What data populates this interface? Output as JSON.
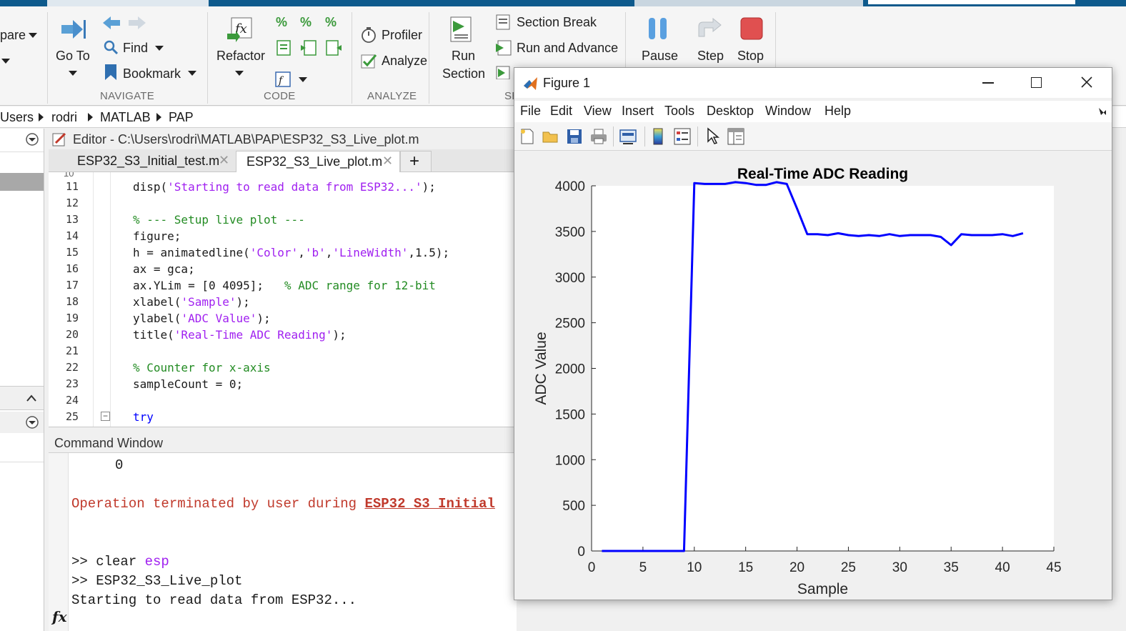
{
  "ribbon": {
    "compare_label": "pare",
    "goto_label": "Go To",
    "find_label": "Find",
    "bookmark_label": "Bookmark",
    "navigate_section": "NAVIGATE",
    "refactor_label": "Refactor",
    "code_section": "CODE",
    "profiler_label": "Profiler",
    "analyze_label": "Analyze",
    "analyze_section": "ANALYZE",
    "run_section_label_1": "Run",
    "run_section_label_2": "Section",
    "section_break_label": "Section Break",
    "run_advance_label": "Run and Advance",
    "section_partial": "SE",
    "pause_label": "Pause",
    "step_label": "Step",
    "stop_label": "Stop"
  },
  "address": {
    "parts": [
      "Users",
      "rodri",
      "MATLAB",
      "PAP"
    ]
  },
  "editor": {
    "title": "Editor - C:\\Users\\rodri\\MATLAB\\PAP\\ESP32_S3_Live_plot.m",
    "tabs": [
      {
        "label": "ESP32_S3_Initial_test.m"
      },
      {
        "label": "ESP32_S3_Live_plot.m"
      }
    ],
    "lines": [
      {
        "n": "11",
        "parts": [
          [
            "",
            "disp("
          ],
          [
            "cstr",
            "'Starting to read data from ESP32...'"
          ],
          [
            "",
            ");"
          ]
        ]
      },
      {
        "n": "12",
        "parts": []
      },
      {
        "n": "13",
        "parts": [
          [
            "ccom",
            "% --- Setup live plot ---"
          ]
        ]
      },
      {
        "n": "14",
        "parts": [
          [
            "",
            "figure;"
          ]
        ]
      },
      {
        "n": "15",
        "parts": [
          [
            "",
            "h = animatedline("
          ],
          [
            "cstr",
            "'Color'"
          ],
          [
            "",
            ","
          ],
          [
            "cstr",
            "'b'"
          ],
          [
            "",
            ","
          ],
          [
            "cstr",
            "'LineWidth'"
          ],
          [
            "",
            ",1.5);"
          ]
        ]
      },
      {
        "n": "16",
        "parts": [
          [
            "",
            "ax = gca;"
          ]
        ]
      },
      {
        "n": "17",
        "parts": [
          [
            "",
            "ax.YLim = [0 4095];   "
          ],
          [
            "ccom",
            "% ADC range for 12-bit"
          ]
        ]
      },
      {
        "n": "18",
        "parts": [
          [
            "",
            "xlabel("
          ],
          [
            "cstr",
            "'Sample'"
          ],
          [
            "",
            ");"
          ]
        ]
      },
      {
        "n": "19",
        "parts": [
          [
            "",
            "ylabel("
          ],
          [
            "cstr",
            "'ADC Value'"
          ],
          [
            "",
            ");"
          ]
        ]
      },
      {
        "n": "20",
        "parts": [
          [
            "",
            "title("
          ],
          [
            "cstr",
            "'Real-Time ADC Reading'"
          ],
          [
            "",
            ");"
          ]
        ]
      },
      {
        "n": "21",
        "parts": []
      },
      {
        "n": "22",
        "parts": [
          [
            "ccom",
            "% Counter for x-axis"
          ]
        ]
      },
      {
        "n": "23",
        "parts": [
          [
            "",
            "sampleCount = 0;"
          ]
        ]
      },
      {
        "n": "24",
        "parts": []
      },
      {
        "n": "25",
        "parts": [
          [
            "ckw",
            "try"
          ]
        ]
      }
    ]
  },
  "command_window": {
    "title": "Command Window",
    "value_line": "0",
    "error_prefix": "Operation terminated by user during ",
    "error_link": "ESP32_S3_Initial",
    "prompt1": ">> clear ",
    "prompt1_arg": "esp",
    "prompt2": ">> ESP32_S3_Live_plot",
    "output": "Starting to read data from ESP32...",
    "fx": "fx"
  },
  "figure": {
    "title": "Figure 1",
    "menus": [
      "File",
      "Edit",
      "View",
      "Insert",
      "Tools",
      "Desktop",
      "Window",
      "Help"
    ]
  },
  "chart_data": {
    "type": "line",
    "title": "Real-Time ADC Reading",
    "xlabel": "Sample",
    "ylabel": "ADC Value",
    "xlim": [
      0,
      45
    ],
    "ylim": [
      0,
      4000
    ],
    "xticks": [
      0,
      5,
      10,
      15,
      20,
      25,
      30,
      35,
      40,
      45
    ],
    "yticks": [
      0,
      500,
      1000,
      1500,
      2000,
      2500,
      3000,
      3500,
      4000
    ],
    "line_color": "#0000ff",
    "grid": false,
    "series": [
      {
        "x": [
          1,
          2,
          3,
          4,
          5,
          6,
          7,
          8,
          9,
          10,
          11,
          12,
          13,
          14,
          15,
          16,
          17,
          18,
          19,
          20,
          21,
          22,
          23,
          24,
          25,
          26,
          27,
          28,
          29,
          30,
          31,
          32,
          33,
          34,
          35,
          36,
          37,
          38,
          39,
          40,
          41,
          42
        ],
        "y": [
          0,
          0,
          0,
          0,
          0,
          0,
          0,
          0,
          0,
          4030,
          4020,
          4020,
          4020,
          4040,
          4030,
          4010,
          4010,
          4040,
          4020,
          3750,
          3470,
          3470,
          3460,
          3480,
          3460,
          3450,
          3460,
          3450,
          3470,
          3450,
          3460,
          3460,
          3460,
          3440,
          3350,
          3470,
          3460,
          3460,
          3460,
          3470,
          3450,
          3480
        ]
      }
    ]
  }
}
